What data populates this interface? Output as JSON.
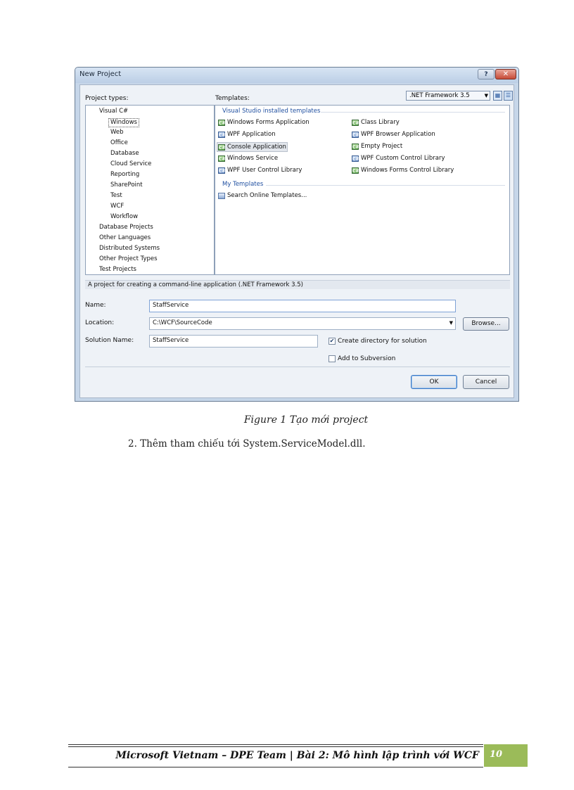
{
  "dialog": {
    "title": "New Project",
    "help_glyph": "?",
    "close_glyph": "✕",
    "project_types_label": "Project types:",
    "templates_label": "Templates:",
    "framework": ".NET Framework 3.5",
    "project_types": [
      {
        "label": "Visual C#",
        "level": 0
      },
      {
        "label": "Windows",
        "level": 1,
        "selected": true
      },
      {
        "label": "Web",
        "level": 1
      },
      {
        "label": "Office",
        "level": 1
      },
      {
        "label": "Database",
        "level": 1
      },
      {
        "label": "Cloud Service",
        "level": 1
      },
      {
        "label": "Reporting",
        "level": 1
      },
      {
        "label": "SharePoint",
        "level": 1
      },
      {
        "label": "Test",
        "level": 1
      },
      {
        "label": "WCF",
        "level": 1
      },
      {
        "label": "Workflow",
        "level": 1
      },
      {
        "label": "Database Projects",
        "level": 0
      },
      {
        "label": "Other Languages",
        "level": 0
      },
      {
        "label": "Distributed Systems",
        "level": 0
      },
      {
        "label": "Other Project Types",
        "level": 0
      },
      {
        "label": "Test Projects",
        "level": 0
      }
    ],
    "installed_group": "Visual Studio installed templates",
    "templates_left": [
      "Windows Forms Application",
      "WPF Application",
      "Console Application",
      "Windows Service",
      "WPF User Control Library"
    ],
    "templates_right": [
      "Class Library",
      "WPF Browser Application",
      "Empty Project",
      "WPF Custom Control Library",
      "Windows Forms Control Library"
    ],
    "selected_template": "Console Application",
    "my_templates_group": "My Templates",
    "my_templates": [
      "Search Online Templates..."
    ],
    "description": "A project for creating a command-line application (.NET Framework 3.5)",
    "name_label": "Name:",
    "name_value": "StaffService",
    "location_label": "Location:",
    "location_value": "C:\\WCF\\SourceCode",
    "browse_label": "Browse...",
    "solution_label": "Solution Name:",
    "solution_value": "StaffService",
    "create_dir_label": "Create directory for solution",
    "create_dir_checked": true,
    "subversion_label": "Add to Subversion",
    "subversion_checked": false,
    "ok_label": "OK",
    "cancel_label": "Cancel"
  },
  "caption": "Figure 1 Tạo mới project",
  "step": "2.   Thêm tham chiếu tới System.ServiceModel.dll.",
  "footer": {
    "text": "Microsoft Vietnam – DPE Team | Bài 2: Mô hình lập trình với WCF",
    "page_number": "10",
    "accent": "#9bbb59"
  }
}
